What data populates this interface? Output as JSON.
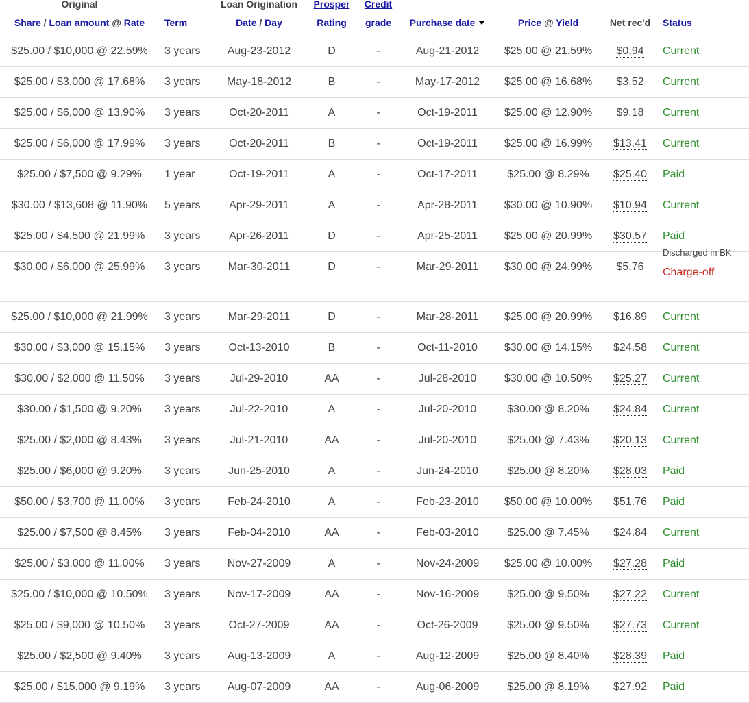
{
  "header": {
    "original": "Original",
    "share": "Share",
    "loan_amount": "Loan amount",
    "at": "@",
    "rate": "Rate",
    "term": "Term",
    "loan_origination": "Loan Origination",
    "date": "Date",
    "day": "Day",
    "prosper": "Prosper",
    "rating": "Rating",
    "credit": "Credit",
    "grade": "grade",
    "purchase_date": "Purchase date",
    "price": "Price",
    "yield": "Yield",
    "net_recd": "Net rec'd",
    "status": "Status",
    "slash": "/"
  },
  "rows": [
    {
      "original": "$25.00 / $10,000 @ 22.59%",
      "term": "3 years",
      "orig_date": "Aug-23-2012",
      "rating": "D",
      "grade": "-",
      "purchase_date": "Aug-21-2012",
      "price_yield": "$25.00 @ 21.59%",
      "net": "$0.94",
      "net_link": true,
      "status": "Current",
      "status_kind": "current",
      "note": ""
    },
    {
      "original": "$25.00 / $3,000 @ 17.68%",
      "term": "3 years",
      "orig_date": "May-18-2012",
      "rating": "B",
      "grade": "-",
      "purchase_date": "May-17-2012",
      "price_yield": "$25.00 @ 16.68%",
      "net": "$3.52",
      "net_link": true,
      "status": "Current",
      "status_kind": "current",
      "note": ""
    },
    {
      "original": "$25.00 / $6,000 @ 13.90%",
      "term": "3 years",
      "orig_date": "Oct-20-2011",
      "rating": "A",
      "grade": "-",
      "purchase_date": "Oct-19-2011",
      "price_yield": "$25.00 @ 12.90%",
      "net": "$9.18",
      "net_link": true,
      "status": "Current",
      "status_kind": "current",
      "note": ""
    },
    {
      "original": "$25.00 / $6,000 @ 17.99%",
      "term": "3 years",
      "orig_date": "Oct-20-2011",
      "rating": "B",
      "grade": "-",
      "purchase_date": "Oct-19-2011",
      "price_yield": "$25.00 @ 16.99%",
      "net": "$13.41",
      "net_link": true,
      "status": "Current",
      "status_kind": "current",
      "note": ""
    },
    {
      "original": "$25.00 / $7,500 @ 9.29%",
      "term": "1 year",
      "orig_date": "Oct-19-2011",
      "rating": "A",
      "grade": "-",
      "purchase_date": "Oct-17-2011",
      "price_yield": "$25.00 @ 8.29%",
      "net": "$25.40",
      "net_link": true,
      "status": "Paid",
      "status_kind": "paid",
      "note": ""
    },
    {
      "original": "$30.00 / $13,608 @ 11.90%",
      "term": "5 years",
      "orig_date": "Apr-29-2011",
      "rating": "A",
      "grade": "-",
      "purchase_date": "Apr-28-2011",
      "price_yield": "$30.00 @ 10.90%",
      "net": "$10.94",
      "net_link": true,
      "status": "Current",
      "status_kind": "current",
      "note": ""
    },
    {
      "original": "$25.00 / $4,500 @ 21.99%",
      "term": "3 years",
      "orig_date": "Apr-26-2011",
      "rating": "D",
      "grade": "-",
      "purchase_date": "Apr-25-2011",
      "price_yield": "$25.00 @ 20.99%",
      "net": "$30.57",
      "net_link": true,
      "status": "Paid",
      "status_kind": "paid",
      "note": ""
    },
    {
      "original": "$30.00 / $6,000 @ 25.99%",
      "term": "3 years",
      "orig_date": "Mar-30-2011",
      "rating": "D",
      "grade": "-",
      "purchase_date": "Mar-29-2011",
      "price_yield": "$30.00 @ 24.99%",
      "net": "$5.76",
      "net_link": true,
      "status": "Charge-off",
      "status_kind": "charge",
      "note": "Discharged in BK"
    },
    {
      "original": "$25.00 / $10,000 @ 21.99%",
      "term": "3 years",
      "orig_date": "Mar-29-2011",
      "rating": "D",
      "grade": "-",
      "purchase_date": "Mar-28-2011",
      "price_yield": "$25.00 @ 20.99%",
      "net": "$16.89",
      "net_link": true,
      "status": "Current",
      "status_kind": "current",
      "note": ""
    },
    {
      "original": "$30.00 / $3,000 @ 15.15%",
      "term": "3 years",
      "orig_date": "Oct-13-2010",
      "rating": "B",
      "grade": "-",
      "purchase_date": "Oct-11-2010",
      "price_yield": "$30.00 @ 14.15%",
      "net": "$24.58",
      "net_link": false,
      "status": "Current",
      "status_kind": "current",
      "note": ""
    },
    {
      "original": "$30.00 / $2,000 @ 11.50%",
      "term": "3 years",
      "orig_date": "Jul-29-2010",
      "rating": "AA",
      "grade": "-",
      "purchase_date": "Jul-28-2010",
      "price_yield": "$30.00 @ 10.50%",
      "net": "$25.27",
      "net_link": true,
      "status": "Current",
      "status_kind": "current",
      "note": ""
    },
    {
      "original": "$30.00 / $1,500 @ 9.20%",
      "term": "3 years",
      "orig_date": "Jul-22-2010",
      "rating": "A",
      "grade": "-",
      "purchase_date": "Jul-20-2010",
      "price_yield": "$30.00 @ 8.20%",
      "net": "$24.84",
      "net_link": true,
      "status": "Current",
      "status_kind": "current",
      "note": ""
    },
    {
      "original": "$25.00 / $2,000 @ 8.43%",
      "term": "3 years",
      "orig_date": "Jul-21-2010",
      "rating": "AA",
      "grade": "-",
      "purchase_date": "Jul-20-2010",
      "price_yield": "$25.00 @ 7.43%",
      "net": "$20.13",
      "net_link": true,
      "status": "Current",
      "status_kind": "current",
      "note": ""
    },
    {
      "original": "$25.00 / $6,000 @ 9.20%",
      "term": "3 years",
      "orig_date": "Jun-25-2010",
      "rating": "A",
      "grade": "-",
      "purchase_date": "Jun-24-2010",
      "price_yield": "$25.00 @ 8.20%",
      "net": "$28.03",
      "net_link": true,
      "status": "Paid",
      "status_kind": "paid",
      "note": ""
    },
    {
      "original": "$50.00 / $3,700 @ 11.00%",
      "term": "3 years",
      "orig_date": "Feb-24-2010",
      "rating": "A",
      "grade": "-",
      "purchase_date": "Feb-23-2010",
      "price_yield": "$50.00 @ 10.00%",
      "net": "$51.76",
      "net_link": true,
      "status": "Paid",
      "status_kind": "paid",
      "note": ""
    },
    {
      "original": "$25.00 / $7,500 @ 8.45%",
      "term": "3 years",
      "orig_date": "Feb-04-2010",
      "rating": "AA",
      "grade": "-",
      "purchase_date": "Feb-03-2010",
      "price_yield": "$25.00 @ 7.45%",
      "net": "$24.84",
      "net_link": true,
      "status": "Current",
      "status_kind": "current",
      "note": ""
    },
    {
      "original": "$25.00 / $3,000 @ 11.00%",
      "term": "3 years",
      "orig_date": "Nov-27-2009",
      "rating": "A",
      "grade": "-",
      "purchase_date": "Nov-24-2009",
      "price_yield": "$25.00 @ 10.00%",
      "net": "$27.28",
      "net_link": true,
      "status": "Paid",
      "status_kind": "paid",
      "note": ""
    },
    {
      "original": "$25.00 / $10,000 @ 10.50%",
      "term": "3 years",
      "orig_date": "Nov-17-2009",
      "rating": "AA",
      "grade": "-",
      "purchase_date": "Nov-16-2009",
      "price_yield": "$25.00 @ 9.50%",
      "net": "$27.22",
      "net_link": true,
      "status": "Current",
      "status_kind": "current",
      "note": ""
    },
    {
      "original": "$25.00 / $9,000 @ 10.50%",
      "term": "3 years",
      "orig_date": "Oct-27-2009",
      "rating": "AA",
      "grade": "-",
      "purchase_date": "Oct-26-2009",
      "price_yield": "$25.00 @ 9.50%",
      "net": "$27.73",
      "net_link": true,
      "status": "Current",
      "status_kind": "current",
      "note": ""
    },
    {
      "original": "$25.00 / $2,500 @ 9.40%",
      "term": "3 years",
      "orig_date": "Aug-13-2009",
      "rating": "A",
      "grade": "-",
      "purchase_date": "Aug-12-2009",
      "price_yield": "$25.00 @ 8.40%",
      "net": "$28.39",
      "net_link": true,
      "status": "Paid",
      "status_kind": "paid",
      "note": ""
    },
    {
      "original": "$25.00 / $15,000 @ 9.19%",
      "term": "3 years",
      "orig_date": "Aug-07-2009",
      "rating": "AA",
      "grade": "-",
      "purchase_date": "Aug-06-2009",
      "price_yield": "$25.00 @ 8.19%",
      "net": "$27.92",
      "net_link": true,
      "status": "Paid",
      "status_kind": "paid",
      "note": ""
    }
  ],
  "colors": {
    "link": "#1a1aa6",
    "status_current": "#2f8f2f",
    "status_paid": "#2f8f2f",
    "status_charge_off": "#c8281e",
    "text": "#444444",
    "row_border": "#dddddd"
  },
  "icons": {
    "sort_indicator": "caret-down-icon"
  }
}
